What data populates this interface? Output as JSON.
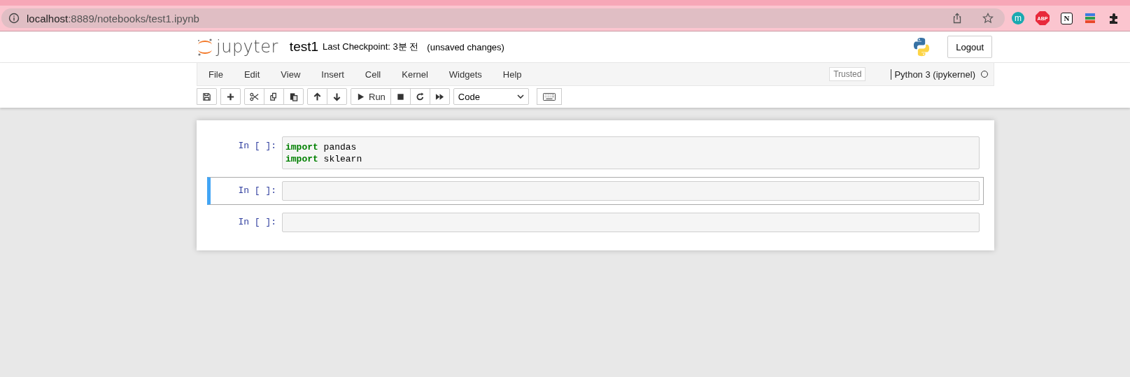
{
  "browser": {
    "url_host": "localhost",
    "url_path": ":8889/notebooks/test1.ipynb",
    "extensions": [
      {
        "kind": "m",
        "label": "m"
      },
      {
        "kind": "abp",
        "label": "ABP"
      },
      {
        "kind": "notion",
        "label": "N"
      },
      {
        "kind": "stack"
      },
      {
        "kind": "puzzle"
      }
    ]
  },
  "header": {
    "logo_text": "jupyter",
    "notebook_name": "test1",
    "checkpoint": "Last Checkpoint: 3분 전",
    "autosave": "(unsaved changes)",
    "logout": "Logout"
  },
  "menubar": {
    "items": [
      "File",
      "Edit",
      "View",
      "Insert",
      "Cell",
      "Kernel",
      "Widgets",
      "Help"
    ],
    "trusted": "Trusted",
    "kernel_name": "Python 3 (ipykernel)",
    "kernel_busy": false
  },
  "toolbar": {
    "groups": [
      [
        {
          "kind": "save"
        }
      ],
      [
        {
          "kind": "plus"
        }
      ],
      [
        {
          "kind": "cut"
        },
        {
          "kind": "copy"
        },
        {
          "kind": "paste"
        }
      ],
      [
        {
          "kind": "up"
        },
        {
          "kind": "down"
        }
      ],
      [
        {
          "kind": "run",
          "label": "Run"
        },
        {
          "kind": "stop"
        },
        {
          "kind": "restart"
        },
        {
          "kind": "fastforward"
        }
      ]
    ],
    "cell_type": "Code"
  },
  "cells": [
    {
      "prompt": "In [ ]:",
      "selected": false,
      "lines": [
        [
          {
            "kind": "keyword",
            "text": "import"
          },
          {
            "kind": "plain",
            "text": " pandas"
          }
        ],
        [
          {
            "kind": "keyword",
            "text": "import"
          },
          {
            "kind": "plain",
            "text": " sklearn"
          }
        ]
      ]
    },
    {
      "prompt": "In [ ]:",
      "selected": true
    },
    {
      "prompt": "In [ ]:",
      "selected": false
    }
  ]
}
